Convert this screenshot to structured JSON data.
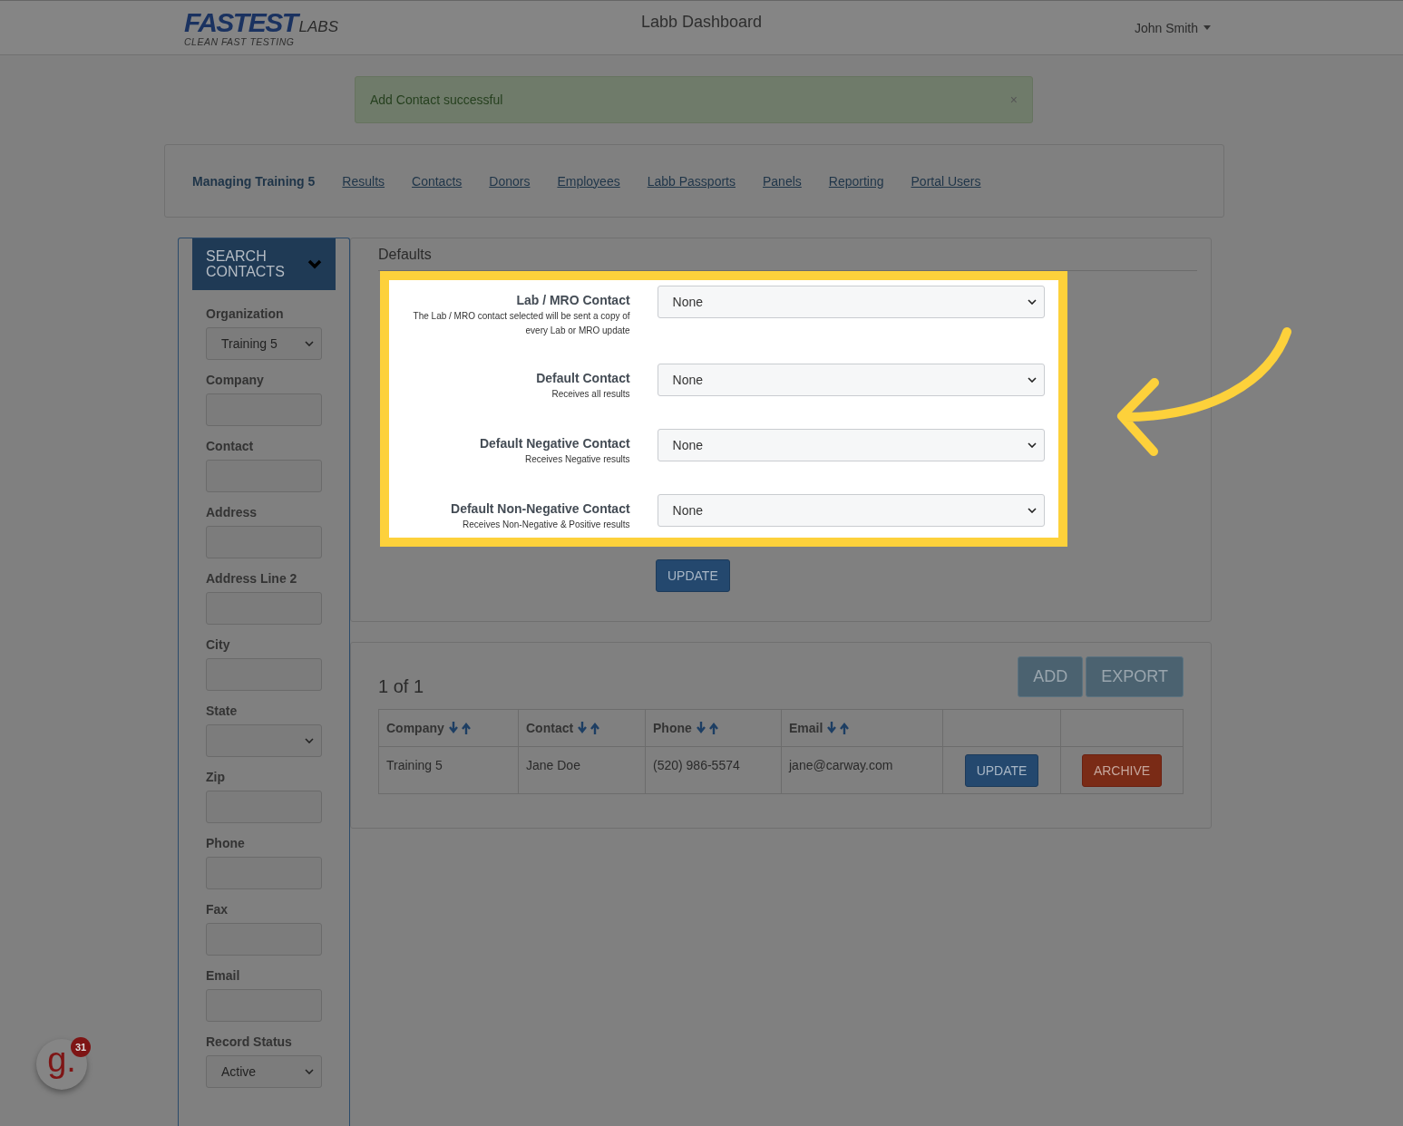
{
  "header": {
    "logo": {
      "wordmark_1": "FASTEST",
      "wordmark_2": "LABS",
      "tagline": "CLEAN FAST TESTING"
    },
    "title": "Labb Dashboard",
    "user_menu": "John Smith"
  },
  "alert": {
    "message": "Add Contact successful",
    "close": "×"
  },
  "nav": {
    "brand": "Managing Training 5",
    "links": [
      "Results",
      "Contacts",
      "Donors",
      "Employees",
      "Labb Passports",
      "Panels",
      "Reporting",
      "Portal Users"
    ]
  },
  "sidebar": {
    "title": "SEARCH CONTACTS",
    "fields": [
      {
        "label": "Organization",
        "kind": "select",
        "value": "Training 5"
      },
      {
        "label": "Company",
        "kind": "text"
      },
      {
        "label": "Contact",
        "kind": "text"
      },
      {
        "label": "Address",
        "kind": "text"
      },
      {
        "label": "Address Line 2",
        "kind": "text"
      },
      {
        "label": "City",
        "kind": "text"
      },
      {
        "label": "State",
        "kind": "select"
      },
      {
        "label": "Zip",
        "kind": "text"
      },
      {
        "label": "Phone",
        "kind": "text"
      },
      {
        "label": "Fax",
        "kind": "text"
      },
      {
        "label": "Email",
        "kind": "text"
      },
      {
        "label": "Record Status",
        "kind": "select",
        "value": "Active"
      }
    ]
  },
  "defaults": {
    "title": "Defaults",
    "highlighted": true,
    "rows": [
      {
        "label": "Lab / MRO Contact",
        "hint": "The Lab / MRO contact selected will be sent a copy of every Lab or MRO update",
        "value": "None"
      },
      {
        "label": "Default Contact",
        "hint": "Receives all results",
        "value": "None"
      },
      {
        "label": "Default Negative Contact",
        "hint": "Receives Negative results",
        "value": "None"
      },
      {
        "label": "Default Non-Negative Contact",
        "hint": "Receives Non-Negative & Positive results",
        "value": "None"
      }
    ],
    "update_button": "UPDATE"
  },
  "contacts": {
    "count": "1 of 1",
    "buttons": [
      "ADD",
      "EXPORT"
    ],
    "columns": [
      "Company",
      "Contact",
      "Phone",
      "Email"
    ],
    "rows": [
      {
        "company": "Training 5",
        "contact": "Jane Doe",
        "phone": "(520) 986-5574",
        "email": "jane@carway.com",
        "update": "UPDATE",
        "archive": "ARCHIVE"
      }
    ]
  },
  "widget": {
    "logo": "g.",
    "badge": "31"
  }
}
